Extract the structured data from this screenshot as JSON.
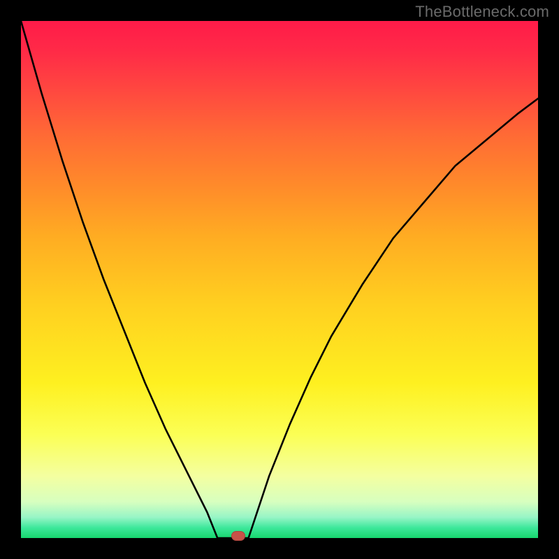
{
  "watermark": "TheBottleneck.com",
  "chart_data": {
    "type": "line",
    "title": "",
    "xlabel": "",
    "ylabel": "",
    "xlim": [
      0,
      1
    ],
    "ylim": [
      0,
      1
    ],
    "grid": false,
    "legend": false,
    "gradient_stops": [
      {
        "pct": 0,
        "color": "#ff1b49"
      },
      {
        "pct": 6,
        "color": "#ff2b47"
      },
      {
        "pct": 14,
        "color": "#ff4a3f"
      },
      {
        "pct": 22,
        "color": "#ff6a35"
      },
      {
        "pct": 32,
        "color": "#ff8b2a"
      },
      {
        "pct": 42,
        "color": "#ffad22"
      },
      {
        "pct": 55,
        "color": "#ffd020"
      },
      {
        "pct": 70,
        "color": "#fef020"
      },
      {
        "pct": 80,
        "color": "#fbff55"
      },
      {
        "pct": 88,
        "color": "#f4ffa0"
      },
      {
        "pct": 93,
        "color": "#d7ffbf"
      },
      {
        "pct": 96,
        "color": "#97f5c6"
      },
      {
        "pct": 98,
        "color": "#3de89b"
      },
      {
        "pct": 100,
        "color": "#17d66e"
      }
    ],
    "floor_range": {
      "start": 0.38,
      "end": 0.44
    },
    "marker": {
      "x": 0.42,
      "y": 0.0
    },
    "series": [
      {
        "name": "left-branch",
        "x": [
          0.0,
          0.04,
          0.08,
          0.12,
          0.16,
          0.2,
          0.24,
          0.28,
          0.32,
          0.36,
          0.38
        ],
        "y": [
          1.0,
          0.86,
          0.73,
          0.61,
          0.5,
          0.4,
          0.3,
          0.21,
          0.13,
          0.05,
          0.0
        ]
      },
      {
        "name": "floor",
        "x": [
          0.38,
          0.44
        ],
        "y": [
          0.0,
          0.0
        ]
      },
      {
        "name": "right-branch",
        "x": [
          0.44,
          0.48,
          0.52,
          0.56,
          0.6,
          0.66,
          0.72,
          0.78,
          0.84,
          0.9,
          0.96,
          1.0
        ],
        "y": [
          0.0,
          0.12,
          0.22,
          0.31,
          0.39,
          0.49,
          0.58,
          0.65,
          0.72,
          0.77,
          0.82,
          0.85
        ]
      }
    ]
  }
}
